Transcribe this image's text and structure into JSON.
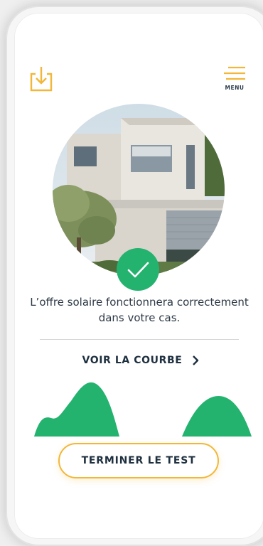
{
  "header": {
    "download_icon": "download-icon",
    "menu_icon": "hamburger-icon",
    "menu_label": "MENU"
  },
  "result": {
    "photo": "house-photo",
    "status_icon": "check-icon",
    "message": "L’offre solaire fonctionnera correctement dans votre cas."
  },
  "curve": {
    "link_label": "VOIR LA COURBE",
    "link_icon": "chevron-right-icon"
  },
  "actions": {
    "finish_label": "TERMINER LE TEST"
  },
  "colors": {
    "accent_orange": "#f2b738",
    "success_green": "#24b26f",
    "text_dark": "#1e2f3f"
  }
}
